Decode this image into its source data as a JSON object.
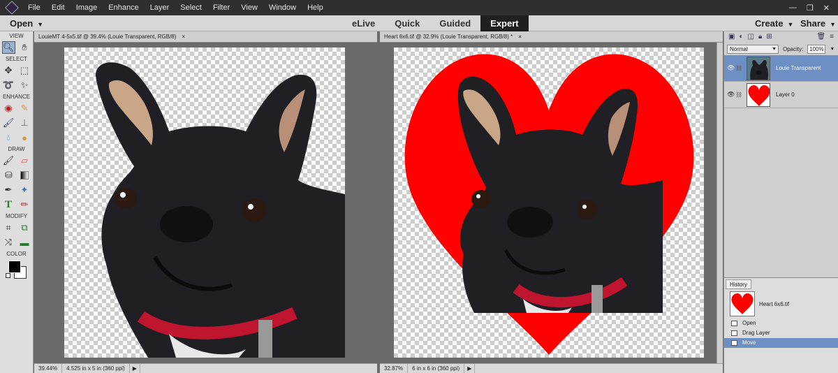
{
  "menubar": {
    "items": [
      "File",
      "Edit",
      "Image",
      "Enhance",
      "Layer",
      "Select",
      "Filter",
      "View",
      "Window",
      "Help"
    ]
  },
  "modebar": {
    "open": "Open",
    "tabs": [
      "eLive",
      "Quick",
      "Guided",
      "Expert"
    ],
    "active_tab": "Expert",
    "create": "Create",
    "share": "Share"
  },
  "toolbox": {
    "sections": [
      "VIEW",
      "SELECT",
      "ENHANCE",
      "DRAW",
      "MODIFY",
      "COLOR"
    ],
    "foreground_color": "#000000",
    "background_color": "#ffffff"
  },
  "documents": [
    {
      "tab": "LouieMT 4-5x5.tif @ 39.4% (Louie Transparent, RGB/8)",
      "zoom": "39.44%",
      "size": "4.525 in x 5 in (360 ppi)"
    },
    {
      "tab": "Heart 6x6.tif @ 32.9% (Louie Transparent, RGB/8) *",
      "zoom": "32.87%",
      "size": "6 in x 6 in (360 ppi)"
    }
  ],
  "close_glyph": "×",
  "layers_panel": {
    "blend_mode": "Normal",
    "opacity_label": "Opacity:",
    "opacity_value": "100%",
    "layers": [
      {
        "name": "Louie Transparent",
        "selected": true
      },
      {
        "name": "Layer 0",
        "selected": false
      }
    ]
  },
  "history": {
    "tab": "History",
    "snapshot": "Heart 6x6.tif",
    "items": [
      "Open",
      "Drag Layer",
      "Move"
    ],
    "selected": "Move"
  },
  "colors": {
    "heart_red": "#ff0000",
    "selection_blue": "#6d8fc4",
    "dog_black": "#1e1e22"
  }
}
